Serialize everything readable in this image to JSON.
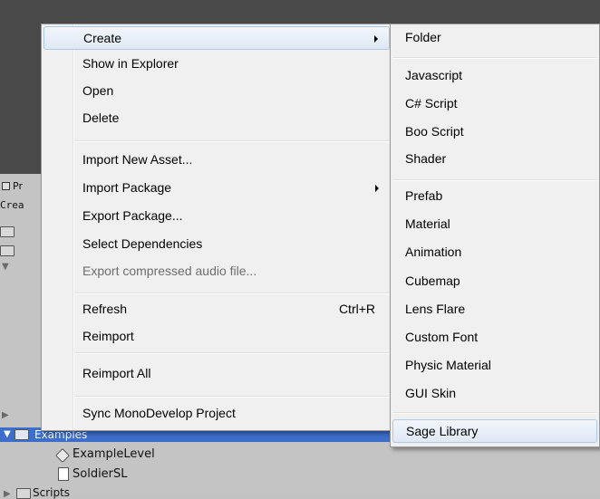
{
  "background": {
    "project_tab": "Pr",
    "create_label": "Crea",
    "selected_folder": "Examples",
    "children": [
      "ExampleLevel",
      "SoldierSL"
    ],
    "next_folder": "Scripts"
  },
  "context_menu": {
    "items": [
      {
        "label": "Create",
        "submenu": true
      },
      {
        "label": "Show in Explorer"
      },
      {
        "label": "Open"
      },
      {
        "label": "Delete"
      },
      {
        "label": "Import New Asset..."
      },
      {
        "label": "Import Package",
        "submenu": true
      },
      {
        "label": "Export Package..."
      },
      {
        "label": "Select Dependencies"
      },
      {
        "label": "Export compressed audio file...",
        "disabled": true
      },
      {
        "label": "Refresh",
        "shortcut": "Ctrl+R"
      },
      {
        "label": "Reimport"
      },
      {
        "label": "Reimport All"
      },
      {
        "label": "Sync MonoDevelop Project"
      }
    ]
  },
  "create_submenu": {
    "items": [
      {
        "label": "Folder"
      },
      {
        "label": "Javascript"
      },
      {
        "label": "C# Script"
      },
      {
        "label": "Boo Script"
      },
      {
        "label": "Shader"
      },
      {
        "label": "Prefab"
      },
      {
        "label": "Material"
      },
      {
        "label": "Animation"
      },
      {
        "label": "Cubemap"
      },
      {
        "label": "Lens Flare"
      },
      {
        "label": "Custom Font"
      },
      {
        "label": "Physic Material"
      },
      {
        "label": "GUI Skin"
      },
      {
        "label": "Sage Library"
      }
    ]
  }
}
